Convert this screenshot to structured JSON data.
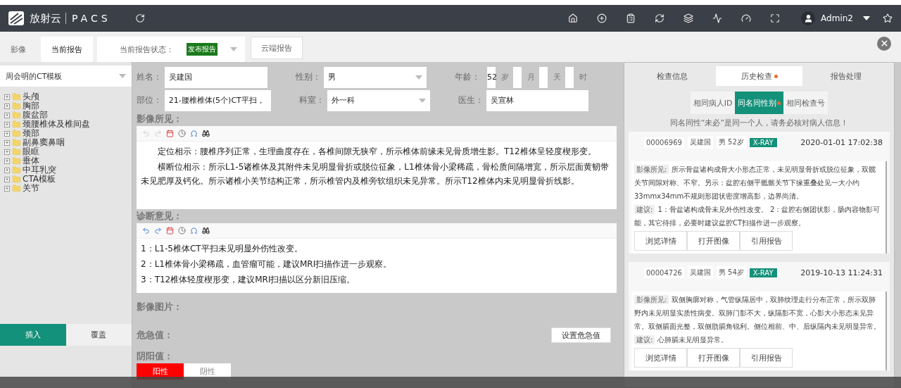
{
  "header": {
    "brand": "放射云",
    "product": "PACS",
    "user": "Admin2"
  },
  "tabs": [
    {
      "label": "影像",
      "selected": false
    },
    {
      "label": "当前报告",
      "selected": true
    }
  ],
  "status": {
    "label": "当前报告状态：",
    "value": "发布报告"
  },
  "cloud_button": "云端报告",
  "template": {
    "value": "周会明的CT模板"
  },
  "tree": [
    {
      "label": "头颅",
      "expanded": false
    },
    {
      "label": "胸部",
      "expanded": false
    },
    {
      "label": "腹盆部",
      "expanded": false
    },
    {
      "label": "颈腰椎体及椎间盘",
      "expanded": false
    },
    {
      "label": "颈部",
      "expanded": false
    },
    {
      "label": "副鼻窦鼻咽",
      "expanded": false
    },
    {
      "label": "眼眶",
      "expanded": false
    },
    {
      "label": "垂体",
      "expanded": false
    },
    {
      "label": "中耳乳突",
      "expanded": false
    },
    {
      "label": "CTA模板",
      "expanded": false
    },
    {
      "label": "关节",
      "expanded": false
    }
  ],
  "mode_buttons": [
    {
      "label": "插入",
      "selected": true
    },
    {
      "label": "覆盖",
      "selected": false
    }
  ],
  "form": {
    "name_label": "姓名：",
    "name": "吴建国",
    "sex_label": "性别：",
    "sex": "男",
    "age_label": "年龄：",
    "age": "52",
    "age_units": [
      "岁",
      "月",
      "天",
      "时"
    ],
    "part_label": "部位：",
    "part": "21-腰椎椎体(5个)CT平扫，",
    "dept_label": "科室：",
    "dept": "外一科",
    "doctor_label": "医生：",
    "doctor": "吴宣林"
  },
  "editors": [
    {
      "title": "影像所见：",
      "undo_enabled": false,
      "paragraphs": [
        "定位相示：腰椎序列正常，生理曲度存在，各椎间隙无狭窄，所示椎体前缘未见骨质增生影。T12椎体呈轻度楔形变。",
        "横断位相示：所示L1-5诸椎体及其附件未见明显骨折或脱位征象，L1椎体骨小梁稀疏，骨松质间隔增宽，所示层面黄韧带未见肥厚及钙化。所示诸椎小关节结构正常，所示椎管内及椎旁软组织未见异常。所示T12椎体内未见明显骨折线影。"
      ]
    },
    {
      "title": "诊断意见：",
      "undo_enabled": true,
      "paragraphs": [
        "1：L1-5椎体CT平扫未见明显外伤性改变。",
        "2：L1椎体骨小梁稀疏，血管瘤可能，建议MRI扫描作进一步观察。",
        "3：T12椎体轻度楔形变，建议MRI扫描以区分新旧压缩。"
      ]
    }
  ],
  "images_label": "影像图片：",
  "critical": {
    "label": "危急值：",
    "button": "设置危急值"
  },
  "yinyang": {
    "label": "阴阳值：",
    "options": [
      {
        "label": "阳性",
        "selected": true
      },
      {
        "label": "阴性",
        "selected": false
      }
    ]
  },
  "side_tabs": [
    {
      "label": "检查信息",
      "selected": false,
      "dot": false
    },
    {
      "label": "历史检查",
      "selected": true,
      "dot": true
    },
    {
      "label": "报告处理",
      "selected": false,
      "dot": false
    }
  ],
  "history_filters": [
    {
      "label": "相同病人ID",
      "selected": false,
      "dot": false
    },
    {
      "label": "同名同性别",
      "selected": true,
      "dot": true
    },
    {
      "label": "相同检查号",
      "selected": false,
      "dot": false
    }
  ],
  "notice": "同名同性“未必”是同一个人，请务必核对病人信息！",
  "history": [
    {
      "id": "00006969",
      "name": "吴建国",
      "sex_age": "男 52岁",
      "modality": "X-RAY",
      "time": "2020-01-01 17:02:38",
      "findings_label": "影像所见:",
      "findings": "所示骨盆诸构成骨大小形态正常，未见明显骨折或脱位征象，双髋关节间隙对称、不窄。另示：盆腔右侧平骶髂关节下缘重叠处见一大小约33mmx34mm不规则形团状密度增高影，边界尚清。",
      "advice_label": "建议:",
      "advice": "1：骨盆诸构成骨未见外伤性改变。 2：盆腔右侧团状影，肠内容物影可能，其它待排，必要时建议盆腔CT扫描作进一步观察。",
      "buttons": [
        "浏览详情",
        "打开图像",
        "引用报告"
      ]
    },
    {
      "id": "00004726",
      "name": "吴建国",
      "sex_age": "男 54岁",
      "modality": "X-RAY",
      "time": "2019-10-13 11:24:31",
      "findings_label": "影像所见:",
      "findings": "双侧胸廓对称，气管纵隔居中，双肺纹理走行分布正常，所示双肺野内未见明显实质性病变。双肺门影不大，纵隔影不宽，心影大小形态未见异常。双侧膈面光整，双侧肋膈角锐利。侧位相前、中、后纵隔内未见明显异常。",
      "advice_label": "建议:",
      "advice": "心肺膈未见明显异常。",
      "buttons": [
        "浏览详情",
        "打开图像",
        "引用报告"
      ]
    }
  ]
}
